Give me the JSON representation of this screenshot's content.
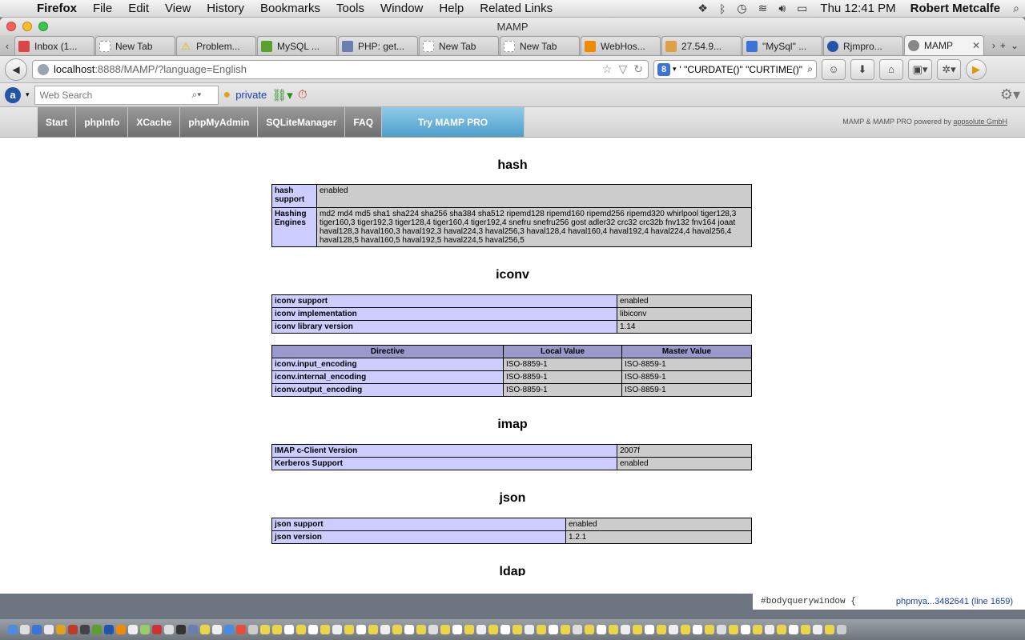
{
  "menubar": {
    "app": "Firefox",
    "items": [
      "File",
      "Edit",
      "View",
      "History",
      "Bookmarks",
      "Tools",
      "Window",
      "Help",
      "Related Links"
    ],
    "clock": "Thu 12:41 PM",
    "user": "Robert Metcalfe"
  },
  "window": {
    "title": "MAMP"
  },
  "tabs": [
    {
      "label": "Inbox (1...",
      "color": "#d44"
    },
    {
      "label": "New Tab",
      "color": "#bbb"
    },
    {
      "label": "Problem...",
      "color": "#e8b400"
    },
    {
      "label": "MySQL ...",
      "color": "#5aa02c"
    },
    {
      "label": "PHP: get...",
      "color": "#6b7eb3"
    },
    {
      "label": "New Tab",
      "color": "#bbb"
    },
    {
      "label": "New Tab",
      "color": "#bbb"
    },
    {
      "label": "WebHos...",
      "color": "#f08a00"
    },
    {
      "label": "27.54.9...",
      "color": "#e0a040"
    },
    {
      "label": "\"MySql\" ...",
      "color": "#3b73d9"
    },
    {
      "label": "Rjmpro...",
      "color": "#2255aa"
    },
    {
      "label": "MAMP",
      "color": "#777",
      "active": true
    }
  ],
  "nav": {
    "url_host": "localhost",
    "url_rest": ":8888/MAMP/?language=English",
    "search_query": "' \"CURDATE()\" \"CURTIME()\""
  },
  "toolbar2": {
    "websearch_placeholder": "Web Search",
    "private_label": "private"
  },
  "mamp": {
    "menu": [
      "Start",
      "phpInfo",
      "XCache",
      "phpMyAdmin",
      "SQLiteManager",
      "FAQ"
    ],
    "pro": "Try MAMP PRO",
    "powered_text": "MAMP & MAMP PRO powered by",
    "powered_link": "appsolute GmbH"
  },
  "sections": {
    "hash": {
      "title": "hash",
      "rows": [
        [
          "hash support",
          "enabled"
        ],
        [
          "Hashing Engines",
          "md2 md4 md5 sha1 sha224 sha256 sha384 sha512 ripemd128 ripemd160 ripemd256 ripemd320 whirlpool tiger128,3 tiger160,3 tiger192,3 tiger128,4 tiger160,4 tiger192,4 snefru snefru256 gost adler32 crc32 crc32b fnv132 fnv164 joaat haval128,3 haval160,3 haval192,3 haval224,3 haval256,3 haval128,4 haval160,4 haval192,4 haval224,4 haval256,4 haval128,5 haval160,5 haval192,5 haval224,5 haval256,5"
        ]
      ]
    },
    "iconv": {
      "title": "iconv",
      "rows": [
        [
          "iconv support",
          "enabled"
        ],
        [
          "iconv implementation",
          "libiconv"
        ],
        [
          "iconv library version",
          "1.14"
        ]
      ],
      "directive_headers": [
        "Directive",
        "Local Value",
        "Master Value"
      ],
      "directives": [
        [
          "iconv.input_encoding",
          "ISO-8859-1",
          "ISO-8859-1"
        ],
        [
          "iconv.internal_encoding",
          "ISO-8859-1",
          "ISO-8859-1"
        ],
        [
          "iconv.output_encoding",
          "ISO-8859-1",
          "ISO-8859-1"
        ]
      ]
    },
    "imap": {
      "title": "imap",
      "rows": [
        [
          "IMAP c-Client Version",
          "2007f"
        ],
        [
          "Kerberos Support",
          "enabled"
        ]
      ]
    },
    "json": {
      "title": "json",
      "rows": [
        [
          "json support",
          "enabled"
        ],
        [
          "json version",
          "1.2.1"
        ]
      ]
    },
    "ldap": {
      "title": "ldap"
    }
  },
  "devpanel": {
    "code": "#bodyquerywindow {",
    "link": "phpmya...3482641 (line 1659)"
  }
}
